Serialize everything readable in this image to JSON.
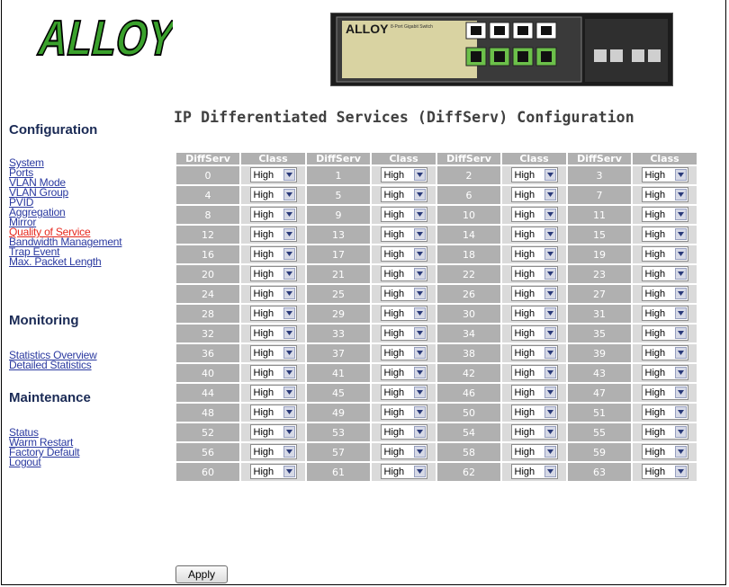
{
  "brand": {
    "logo_text": "ALLOY",
    "device_label": "8-Port Gigabit Switch",
    "device_logo": "ALLOY"
  },
  "page_title": "IP Differentiated Services (DiffServ) Configuration",
  "sidebar": {
    "sections": [
      {
        "title": "Configuration",
        "links": [
          {
            "label": "System",
            "active": false
          },
          {
            "label": "Ports",
            "active": false
          },
          {
            "label": "VLAN Mode",
            "active": false
          },
          {
            "label": "VLAN Group",
            "active": false
          },
          {
            "label": "PVID",
            "active": false
          },
          {
            "label": "Aggregation",
            "active": false
          },
          {
            "label": "Mirror",
            "active": false
          },
          {
            "label": "Quality of Service",
            "active": true
          },
          {
            "label": "Bandwidth Management",
            "active": false
          },
          {
            "label": "Trap Event",
            "active": false
          },
          {
            "label": "Max. Packet Length",
            "active": false
          }
        ]
      },
      {
        "title": "Monitoring",
        "links": [
          {
            "label": "Statistics Overview",
            "active": false
          },
          {
            "label": "Detailed Statistics",
            "active": false
          }
        ]
      },
      {
        "title": "Maintenance",
        "links": [
          {
            "label": "Status",
            "active": false
          },
          {
            "label": "Warm Restart",
            "active": false
          },
          {
            "label": "Factory Default",
            "active": false
          },
          {
            "label": "Logout",
            "active": false
          }
        ]
      }
    ]
  },
  "table": {
    "headers": [
      "DiffServ",
      "Class",
      "DiffServ",
      "Class",
      "DiffServ",
      "Class",
      "DiffServ",
      "Class"
    ],
    "class_option": "High",
    "rows": [
      [
        "0",
        "1",
        "2",
        "3"
      ],
      [
        "4",
        "5",
        "6",
        "7"
      ],
      [
        "8",
        "9",
        "10",
        "11"
      ],
      [
        "12",
        "13",
        "14",
        "15"
      ],
      [
        "16",
        "17",
        "18",
        "19"
      ],
      [
        "20",
        "21",
        "22",
        "23"
      ],
      [
        "24",
        "25",
        "26",
        "27"
      ],
      [
        "28",
        "29",
        "30",
        "31"
      ],
      [
        "32",
        "33",
        "34",
        "35"
      ],
      [
        "36",
        "37",
        "38",
        "39"
      ],
      [
        "40",
        "41",
        "42",
        "43"
      ],
      [
        "44",
        "45",
        "46",
        "47"
      ],
      [
        "48",
        "49",
        "50",
        "51"
      ],
      [
        "52",
        "53",
        "54",
        "55"
      ],
      [
        "56",
        "57",
        "58",
        "59"
      ],
      [
        "60",
        "61",
        "62",
        "63"
      ]
    ]
  },
  "apply_label": "Apply",
  "colors": {
    "header_cell": "#b0b0b0",
    "class_cell": "#dadada",
    "link": "#2b3aa0",
    "active_link": "#e6281e",
    "logo_green": "#3aa12c"
  }
}
